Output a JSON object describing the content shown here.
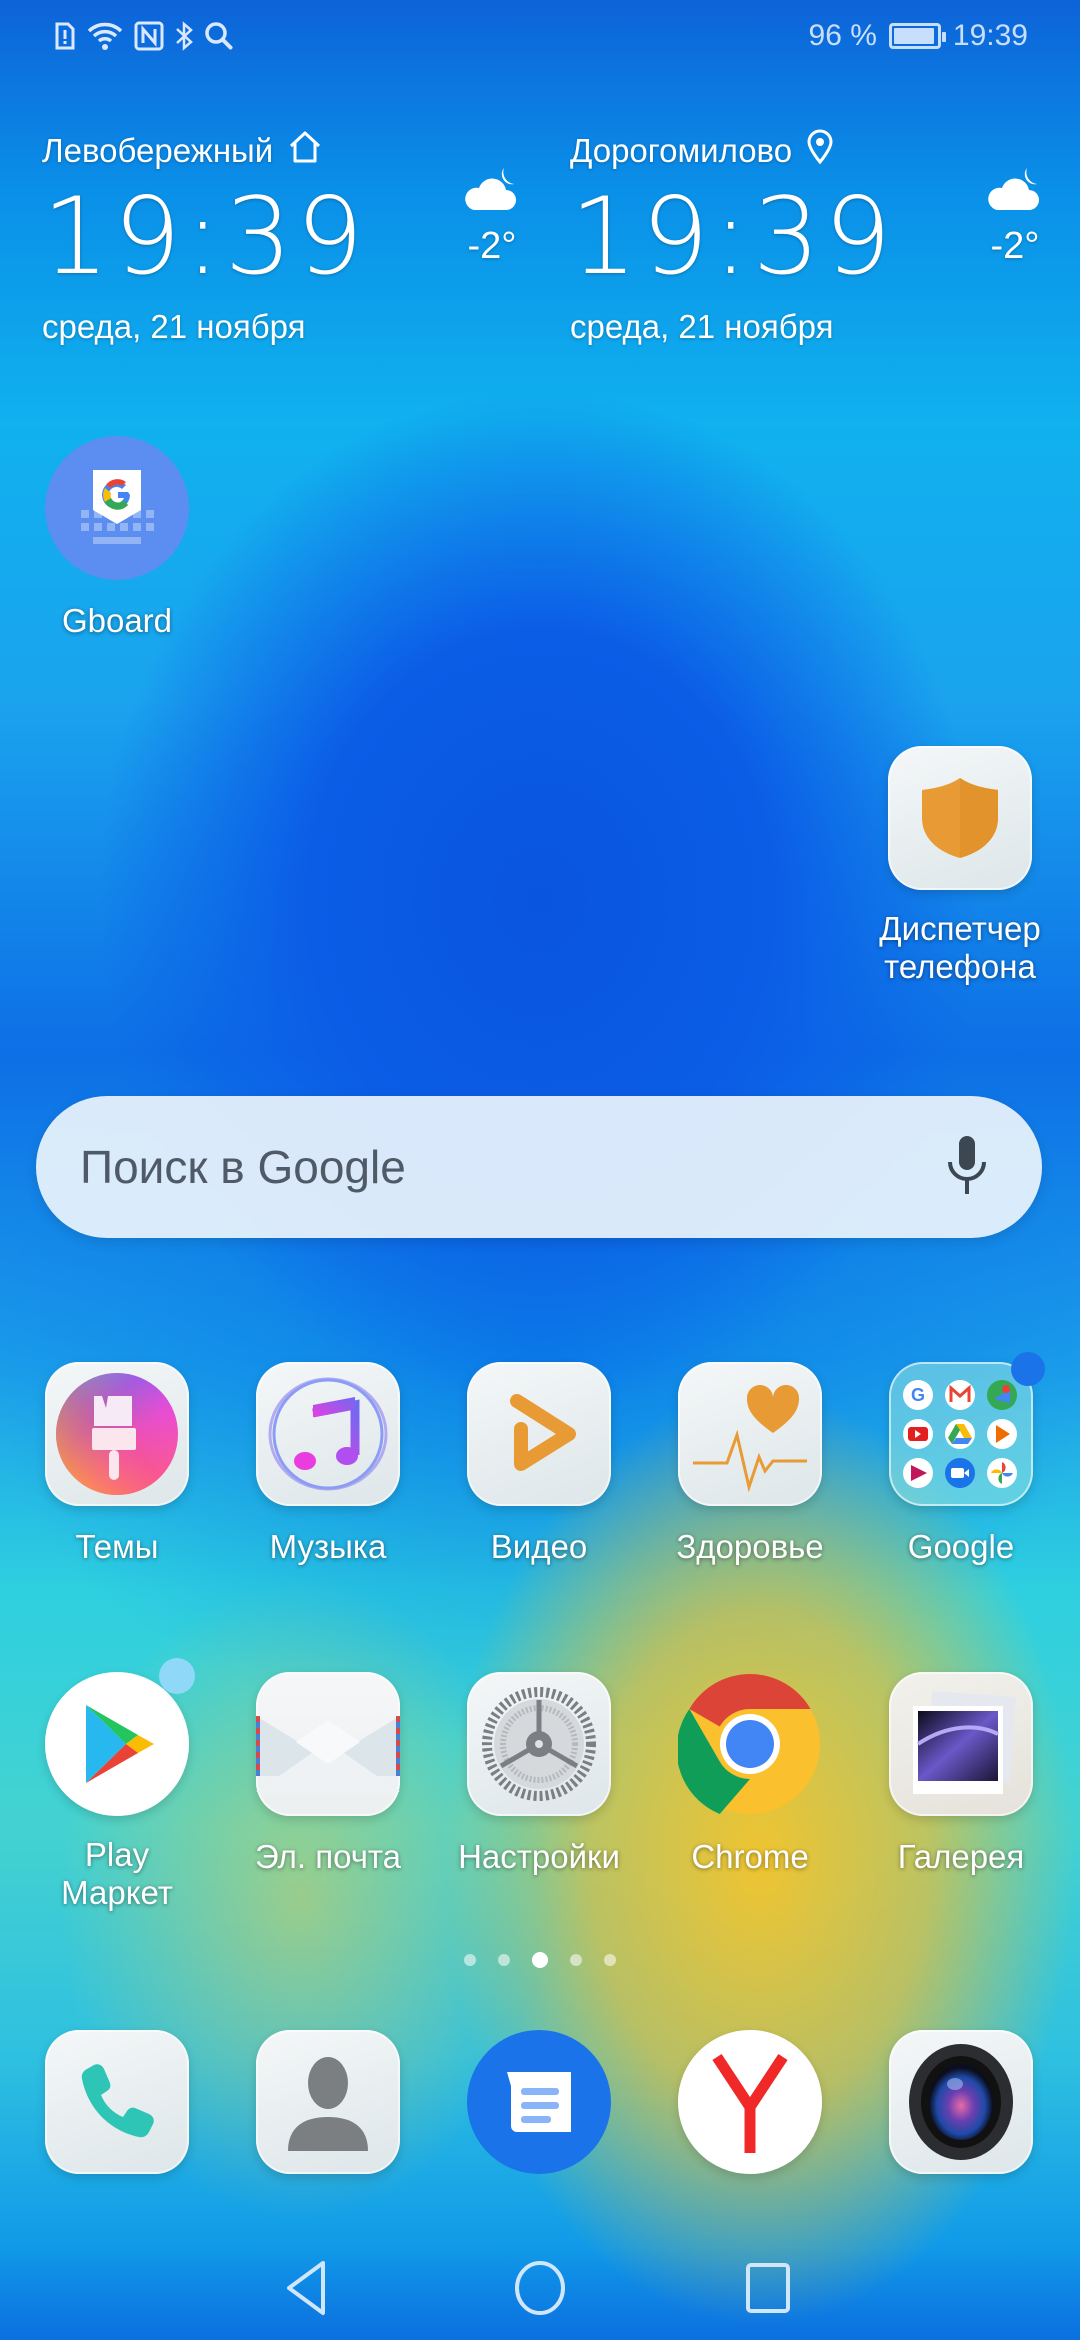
{
  "status_bar": {
    "left_icons": [
      "sim-alert-icon",
      "wifi-icon",
      "nfc-icon",
      "bluetooth-icon",
      "search-icon"
    ],
    "battery_percent_label": "96 %",
    "battery_level": 0.96,
    "time": "19:39"
  },
  "clock_widgets": [
    {
      "place": "Левобережный",
      "place_icon": "home-icon",
      "time": "19:39",
      "date": "среда, 21 ноября",
      "weather_icon": "cloud-moon-icon",
      "temperature": "-2°"
    },
    {
      "place": "Дорогомилово",
      "place_icon": "location-pin-icon",
      "time": "19:39",
      "date": "среда, 21 ноября",
      "weather_icon": "cloud-moon-icon",
      "temperature": "-2°"
    }
  ],
  "apps": {
    "gboard": {
      "label": "Gboard"
    },
    "phone_manager": {
      "label": "Диспетчер телефона"
    },
    "row1": [
      {
        "label": "Темы",
        "icon": "themes-brush-icon"
      },
      {
        "label": "Музыка",
        "icon": "music-note-icon"
      },
      {
        "label": "Видео",
        "icon": "video-play-icon"
      },
      {
        "label": "Здоровье",
        "icon": "health-heart-icon"
      },
      {
        "label": "Google",
        "icon": "google-folder-icon",
        "has_badge": true
      }
    ],
    "row2": [
      {
        "label": "Play Маркет",
        "icon": "play-store-icon",
        "has_badge": true
      },
      {
        "label": "Эл. почта",
        "icon": "email-envelope-icon"
      },
      {
        "label": "Настройки",
        "icon": "settings-gear-icon"
      },
      {
        "label": "Chrome",
        "icon": "chrome-icon"
      },
      {
        "label": "Галерея",
        "icon": "gallery-photo-icon"
      }
    ],
    "google_folder_apps": [
      "Google",
      "Gmail",
      "Maps",
      "YouTube",
      "Drive",
      "Play Music",
      "Play Movies",
      "Duo",
      "Photos"
    ]
  },
  "search": {
    "placeholder": "Поиск в Google",
    "mic_icon": "microphone-icon"
  },
  "page_indicator": {
    "pages": 5,
    "current_page": 3,
    "first_is_home_feed": true
  },
  "dock": [
    {
      "name": "phone",
      "icon": "phone-icon"
    },
    {
      "name": "contacts",
      "icon": "contacts-icon"
    },
    {
      "name": "messages",
      "icon": "messages-icon"
    },
    {
      "name": "yandex-browser",
      "icon": "yandex-icon"
    },
    {
      "name": "camera",
      "icon": "camera-icon"
    }
  ],
  "navigation": {
    "back": "back-icon",
    "home": "home-circle-icon",
    "recents": "recents-square-icon"
  },
  "colors": {
    "google_blue": "#4285F4",
    "google_red": "#EA4335",
    "google_yellow": "#FBBC05",
    "google_green": "#34A853",
    "huawei_orange": "#E89A34",
    "badge_blue": "#1A73E8",
    "badge_light_blue": "#8fd8f8"
  }
}
